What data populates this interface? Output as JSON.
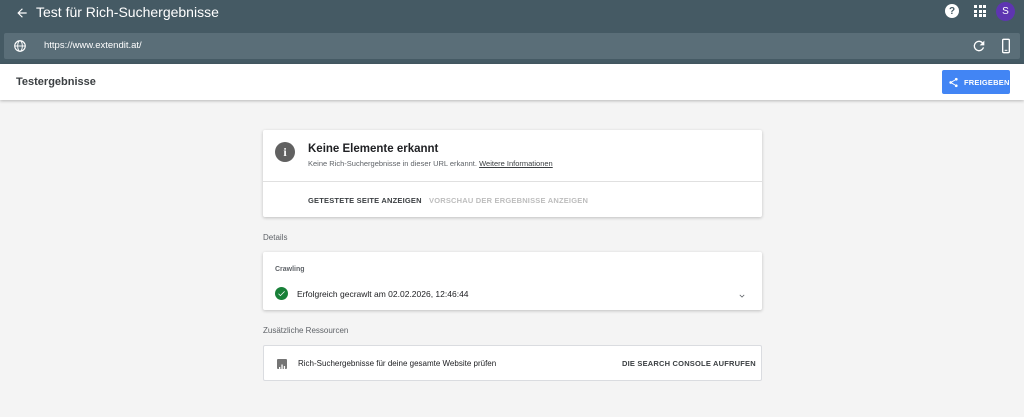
{
  "app": {
    "title": "Test für Rich-Suchergebnisse",
    "avatar_initial": "S",
    "help_symbol": "?"
  },
  "urlbar": {
    "url": "https://www.extendit.at/"
  },
  "results_header": {
    "title": "Testergebnisse",
    "share_label": "FREIGEBEN"
  },
  "main_card": {
    "title": "Keine Elemente erkannt",
    "subtitle": "Keine Rich-Suchergebnisse in dieser URL erkannt.",
    "more_info_link": "Weitere Informationen",
    "tested_page_button": "GETESTETE SEITE ANZEIGEN",
    "preview_button": "VORSCHAU DER ERGEBNISSE ANZEIGEN"
  },
  "details": {
    "section_label": "Details",
    "crawling_label": "Crawling",
    "crawl_status": "Erfolgreich gecrawlt am 02.02.2026, 12:46:44"
  },
  "resources": {
    "section_label": "Zusätzliche Ressourcen",
    "text": "Rich-Suchergebnisse für deine gesamte Website prüfen",
    "link": "DIE SEARCH CONSOLE AUFRUFEN"
  },
  "colors": {
    "topbar": "#455a64",
    "accent": "#4285f4",
    "success": "#188038",
    "avatar": "#5e35b1"
  }
}
